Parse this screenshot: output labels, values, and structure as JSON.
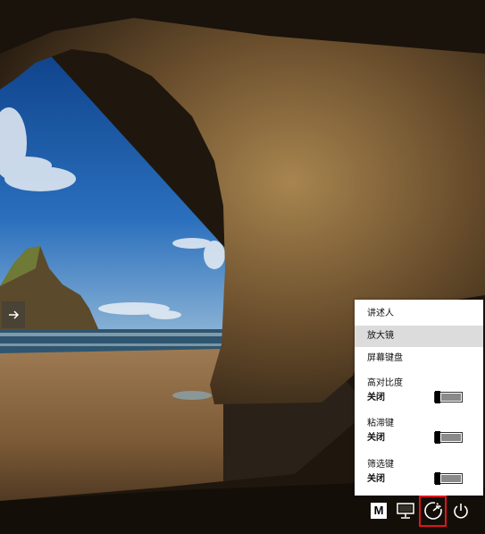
{
  "accessibility_menu": {
    "items": [
      {
        "label": "讲述人"
      },
      {
        "label": "放大镜"
      },
      {
        "label": "屏幕键盘"
      }
    ],
    "toggles": [
      {
        "label": "高对比度",
        "state": "关闭"
      },
      {
        "label": "粘滞键",
        "state": "关闭"
      },
      {
        "label": "筛选键",
        "state": "关闭"
      }
    ]
  },
  "taskbar": {
    "input_indicator": "M"
  },
  "colors": {
    "highlight": "#e0141c",
    "menu_hover": "#dcdcdc"
  },
  "icons": [
    "arrow-right-icon",
    "input-method-icon",
    "network-icon",
    "ease-of-access-icon",
    "power-icon"
  ]
}
